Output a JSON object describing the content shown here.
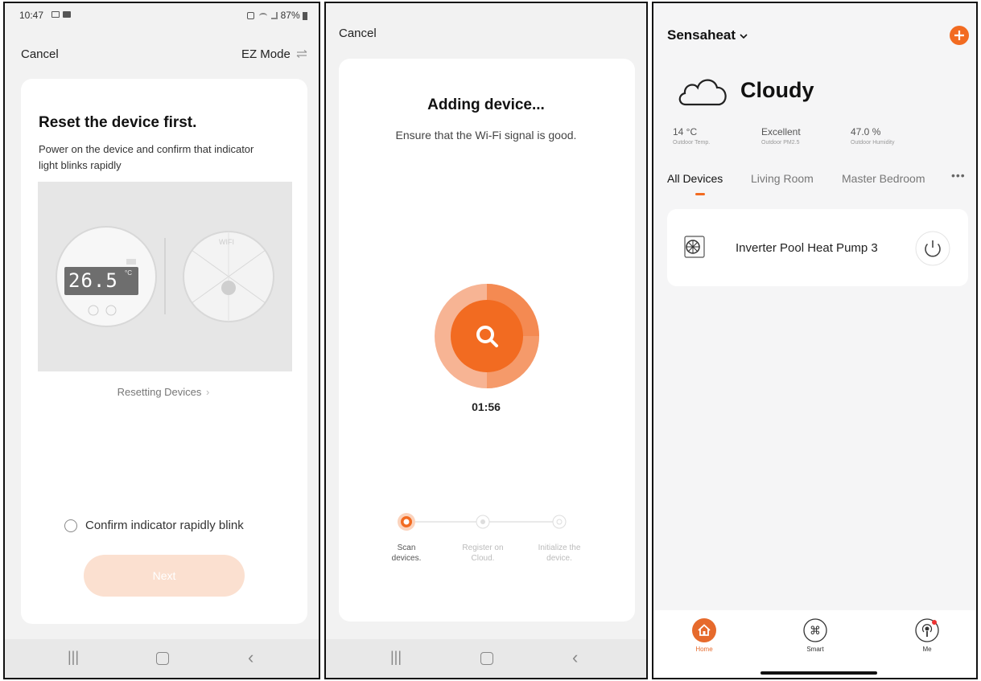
{
  "panel1": {
    "status": {
      "time": "10:47",
      "right": "87%"
    },
    "cancel": "Cancel",
    "mode": "EZ Mode",
    "title": "Reset the device first.",
    "description": "Power on the device and confirm that indicator light blinks rapidly",
    "display_value": "26.5",
    "display_unit": "°C",
    "wifi_label": "WIFI",
    "link": "Resetting Devices",
    "confirm": "Confirm indicator rapidly blink",
    "next": "Next"
  },
  "panel2": {
    "cancel": "Cancel",
    "title": "Adding device...",
    "subtitle": "Ensure that the Wi-Fi signal is good.",
    "timer": "01:56",
    "steps": [
      {
        "label1": "Scan",
        "label2": "devices."
      },
      {
        "label1": "Register on",
        "label2": "Cloud."
      },
      {
        "label1": "Initialize the",
        "label2": "device."
      }
    ]
  },
  "panel3": {
    "home": "Sensaheat",
    "weather": "Cloudy",
    "stats": [
      {
        "value": "14 °C",
        "label": "Outdoor Temp."
      },
      {
        "value": "Excellent",
        "label": "Outdoor PM2.5"
      },
      {
        "value": "47.0 %",
        "label": "Outdoor Humidity"
      }
    ],
    "tabs": [
      "All Devices",
      "Living Room",
      "Master Bedroom"
    ],
    "device": "Inverter Pool Heat Pump 3",
    "nav": [
      "Home",
      "Smart",
      "Me"
    ]
  },
  "colors": {
    "accent": "#f26b21",
    "accent_light": "#fbe0d0"
  },
  "icons": [
    "search-icon",
    "power-icon",
    "home-icon",
    "command-icon",
    "podcast-icon",
    "plus-icon",
    "cloud-icon",
    "switch-mode-icon"
  ]
}
